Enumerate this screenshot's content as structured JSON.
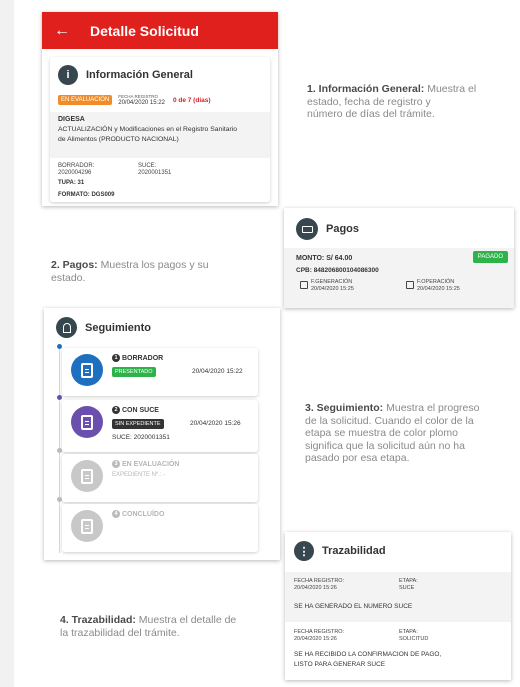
{
  "screen1": {
    "title": "Detalle Solicitud",
    "section_title": "Información General",
    "status_badge": "EN EVALUACIÓN",
    "fecha_label": "FECHA REGISTRO",
    "fecha_value": "20/04/2020 15:22",
    "days": "0 de 7 (días)",
    "entity": "DIGESA",
    "procedure_line1": "ACTUALIZACIÓN y Modificaciones en el Registro Sanitario",
    "procedure_line2": "de Alimentos (PRODUCTO NACIONAL)",
    "borrador_label": "BORRADOR:",
    "borrador_value": "2020004296",
    "suce_label": "SUCE:",
    "suce_value": "2020001351",
    "tupa": "TUPA: 31",
    "formato": "FORMATO: DGS009"
  },
  "desc1": {
    "bold": "1. Información General:",
    "line1": " Muestra el",
    "line2": "estado, fecha de registro y",
    "line3": "número de días del trámite."
  },
  "screen2": {
    "title": "Pagos",
    "monto": "MONTO: S/ 64.00",
    "status": "PAGADO",
    "cpb": "CPB: 848206800104086300",
    "gen_label": "F.GENERACIÓN",
    "gen_value": "20/04/2020 15:25",
    "op_label": "F.OPERACIÓN",
    "op_value": "20/04/2020 15:25"
  },
  "desc2": {
    "bold": "2. Pagos:",
    "line1": " Muestra los pagos y su",
    "line2": "estado."
  },
  "screen3": {
    "title": "Seguimiento",
    "steps": [
      {
        "num": "1",
        "name": "BORRADOR",
        "badge": "PRESENTADO",
        "date": "20/04/2020 15:22"
      },
      {
        "num": "2",
        "name": "CON SUCE",
        "badge": "SIN EXPEDIENTE",
        "date": "20/04/2020 15:26",
        "extra": "SUCE: 2020001351"
      },
      {
        "num": "3",
        "name": "EN EVALUACIÓN",
        "extra": "EXPEDIENTE Nº.: -"
      },
      {
        "num": "4",
        "name": "CONCLUÍDO"
      }
    ]
  },
  "desc3": {
    "bold": "3. Seguimiento:",
    "line1": " Muestra el progreso",
    "line2": "de la solicitud. Cuando el color de la",
    "line3": "etapa se muestra de color plomo",
    "line4": "significa que la solicitud aún no ha",
    "line5": "pasado por esa etapa."
  },
  "screen4": {
    "title": "Trazabilidad",
    "entries": [
      {
        "fecha_label": "FECHA REGISTRO:",
        "fecha": "20/04/2020 15:26",
        "etapa_label": "ETAPA:",
        "etapa": "SUCE",
        "message": "SE HA GENERADO EL NUMERO SUCE"
      },
      {
        "fecha_label": "FECHA REGISTRO:",
        "fecha": "20/04/2020 15:26",
        "etapa_label": "ETAPA:",
        "etapa": "SOLICITUD",
        "message": "SE HA RECIBIDO LA CONFIRMACION DE PAGO,",
        "message2": "LISTO PARA GENERAR SUCE"
      }
    ]
  },
  "desc4": {
    "bold": "4. Trazabilidad:",
    "line1": " Muestra el detalle de",
    "line2": "la trazabilidad del trámite."
  },
  "colors": {
    "accent": "#e0201d",
    "blue": "#1e6fc0",
    "purple": "#6a4fae",
    "green": "#2eb24a",
    "grey": "#bdbdbd"
  }
}
